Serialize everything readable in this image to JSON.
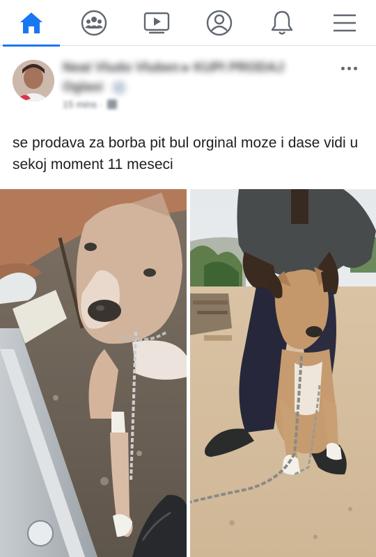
{
  "nav": {
    "tabs": [
      {
        "name": "home",
        "icon": "home-icon",
        "active": true
      },
      {
        "name": "groups",
        "icon": "groups-icon",
        "active": false
      },
      {
        "name": "watch",
        "icon": "watch-icon",
        "active": false
      },
      {
        "name": "profile",
        "icon": "profile-icon",
        "active": false
      },
      {
        "name": "notifications",
        "icon": "bell-icon",
        "active": false
      },
      {
        "name": "menu",
        "icon": "menu-icon",
        "active": false
      }
    ],
    "accent_color": "#1877f2",
    "inactive_color": "#606770"
  },
  "post": {
    "author": "Neat Vludo Vluben ▸ KUPI PRODAJ Oglasi",
    "timestamp": "15 mins ·",
    "text": "se prodava za borba pit bul orginal moze i dase vidi u sekoj moment 11 meseci",
    "photos": [
      {
        "description_icon": "dog-photo-closeup"
      },
      {
        "description_icon": "dog-photo-standing"
      }
    ]
  }
}
